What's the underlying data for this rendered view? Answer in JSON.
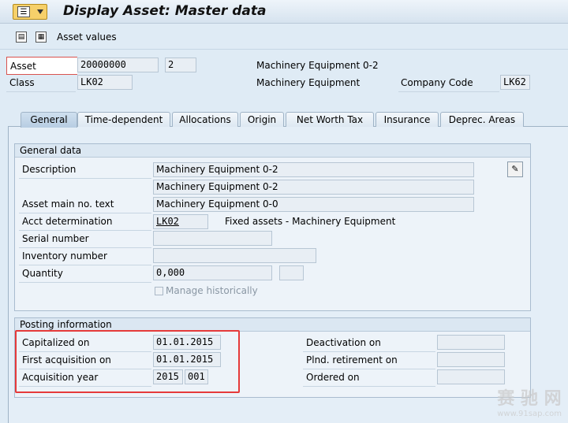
{
  "window": {
    "title": "Display Asset:  Master data"
  },
  "toolbar": {
    "asset_values_label": "Asset values"
  },
  "header": {
    "asset_label": "Asset",
    "asset_number": "20000000",
    "sub_number": "2",
    "asset_description": "Machinery Equipment 0-2",
    "class_label": "Class",
    "class_value": "LK02",
    "class_description": "Machinery Equipment",
    "company_code_label": "Company Code",
    "company_code_value": "LK62"
  },
  "tabs": [
    {
      "label": "General"
    },
    {
      "label": "Time-dependent"
    },
    {
      "label": "Allocations"
    },
    {
      "label": "Origin"
    },
    {
      "label": "Net Worth Tax"
    },
    {
      "label": "Insurance"
    },
    {
      "label": "Deprec. Areas"
    }
  ],
  "general_data": {
    "title": "General data",
    "description_label": "Description",
    "description_1": "Machinery Equipment 0-2",
    "description_2": "Machinery Equipment 0-2",
    "main_no_text_label": "Asset main no. text",
    "main_no_text_value": "Machinery Equipment 0-0",
    "acct_det_label": "Acct determination",
    "acct_det_value": "LK02",
    "acct_det_text": "Fixed assets - Machinery Equipment",
    "serial_label": "Serial number",
    "serial_value": "",
    "inventory_label": "Inventory number",
    "inventory_value": "",
    "quantity_label": "Quantity",
    "quantity_value": "0,000",
    "quantity_unit": "",
    "manage_hist_label": "Manage historically"
  },
  "posting_info": {
    "title": "Posting information",
    "capitalized_label": "Capitalized on",
    "capitalized_value": "01.01.2015",
    "first_acq_label": "First acquisition on",
    "first_acq_value": "01.01.2015",
    "acq_year_label": "Acquisition year",
    "acq_year_value": "2015",
    "acq_period_value": "001",
    "deactivation_label": "Deactivation on",
    "deactivation_value": "",
    "plnd_retirement_label": "Plnd. retirement on",
    "plnd_retirement_value": "",
    "ordered_label": "Ordered on",
    "ordered_value": ""
  },
  "watermark": {
    "text": "赛 驰 网",
    "url_text": "www.91sap.com"
  }
}
